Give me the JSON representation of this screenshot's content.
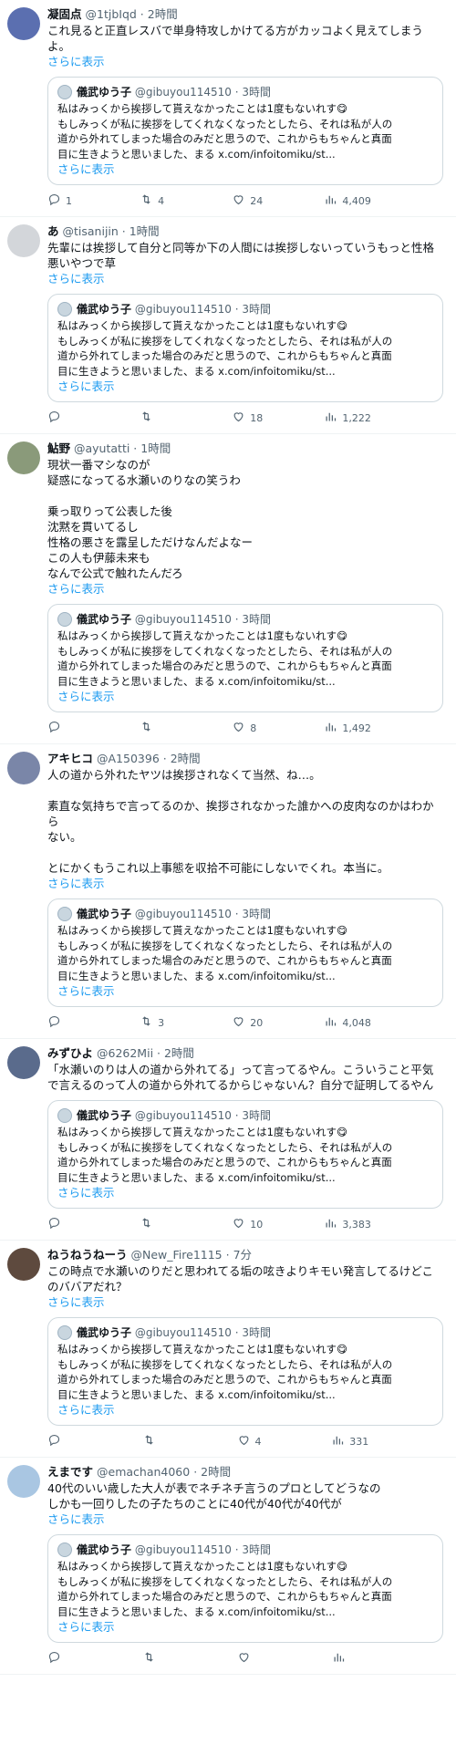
{
  "quote": {
    "name": "儀武ゆう子",
    "handle": "@gibuyou114510",
    "time": "3時間",
    "lines": [
      "私はみっくから挨拶して貰えなかったことは1度もないれす😋",
      "もしみっくが私に挨拶をしてくれなくなったとしたら、それは私が人の",
      "道から外れてしまった場合のみだと思うので、これからもちゃんと真面",
      "目に生きようと思いました、まる x.com/infoitomiku/st..."
    ],
    "more": "さらに表示"
  },
  "tweets": [
    {
      "name": "凝固点",
      "handle": "@1tjbIqd",
      "time": "2時間",
      "lines": [
        "これ見ると正直レスバで単身特攻しかけてる方がカッコよく見えてしまう",
        "よ。"
      ],
      "more": "さらに表示",
      "replies": "1",
      "retweets": "4",
      "likes": "24",
      "views": "4,409",
      "avatar_color": "#5b6fb0"
    },
    {
      "name": "あ",
      "handle": "@tisanijin",
      "time": "1時間",
      "lines": [
        "先輩には挨拶して自分と同等か下の人間には挨拶しないっていうもっと性格",
        "悪いやつで草"
      ],
      "more": "さらに表示",
      "replies": "",
      "retweets": "",
      "likes": "18",
      "views": "1,222",
      "avatar_color": "#d3d6da"
    },
    {
      "name": "鮎野",
      "handle": "@ayutatti",
      "time": "1時間",
      "lines": [
        "現状一番マシなのが",
        "疑惑になってる水瀬いのりなの笑うわ",
        "",
        "乗っ取りって公表した後",
        "沈黙を貫いてるし",
        "性格の悪さを露呈しただけなんだよなー",
        "この人も伊藤未来も",
        "なんで公式で触れたんだろ"
      ],
      "more": "さらに表示",
      "replies": "",
      "retweets": "",
      "likes": "8",
      "views": "1,492",
      "avatar_color": "#8a9a7a"
    },
    {
      "name": "アキヒコ",
      "handle": "@A150396",
      "time": "2時間",
      "lines": [
        "人の道から外れたヤツは挨拶されなくて当然、ね…。",
        "",
        "素直な気持ちで言ってるのか、挨拶されなかった誰かへの皮肉なのかはわから",
        "ない。",
        "",
        "とにかくもうこれ以上事態を収拾不可能にしないでくれ。本当に。"
      ],
      "more": "さらに表示",
      "replies": "",
      "retweets": "3",
      "likes": "20",
      "views": "4,048",
      "avatar_color": "#7a86a8"
    },
    {
      "name": "みずひよ",
      "handle": "@6262Mii",
      "time": "2時間",
      "lines": [
        "「水瀬いのりは人の道から外れてる」って言ってるやん。こういうこと平気",
        "で言えるのって人の道から外れてるからじゃないん？自分で証明してるやん"
      ],
      "more": "",
      "replies": "",
      "retweets": "",
      "likes": "10",
      "views": "3,383",
      "avatar_color": "#5a6b8c"
    },
    {
      "name": "ねうねうねーう",
      "handle": "@New_Fire1115",
      "time": "7分",
      "lines": [
        "この時点で水瀬いのりだと思われてる垢の呟きよりキモい発言してるけどこ",
        "のババアだれ？"
      ],
      "more": "さらに表示",
      "replies": "",
      "retweets": "",
      "likes": "4",
      "views": "331",
      "avatar_color": "#5e4a3e"
    },
    {
      "name": "えまです",
      "handle": "@emachan4060",
      "time": "2時間",
      "lines": [
        "40代のいい歳した大人が表でネチネチ言うのプロとしてどうなの",
        "しかも一回りしたの子たちのことに40代が40代が40代が"
      ],
      "more": "さらに表示",
      "replies": "",
      "retweets": "",
      "likes": "",
      "views": "",
      "avatar_color": "#a9c6e2"
    }
  ]
}
